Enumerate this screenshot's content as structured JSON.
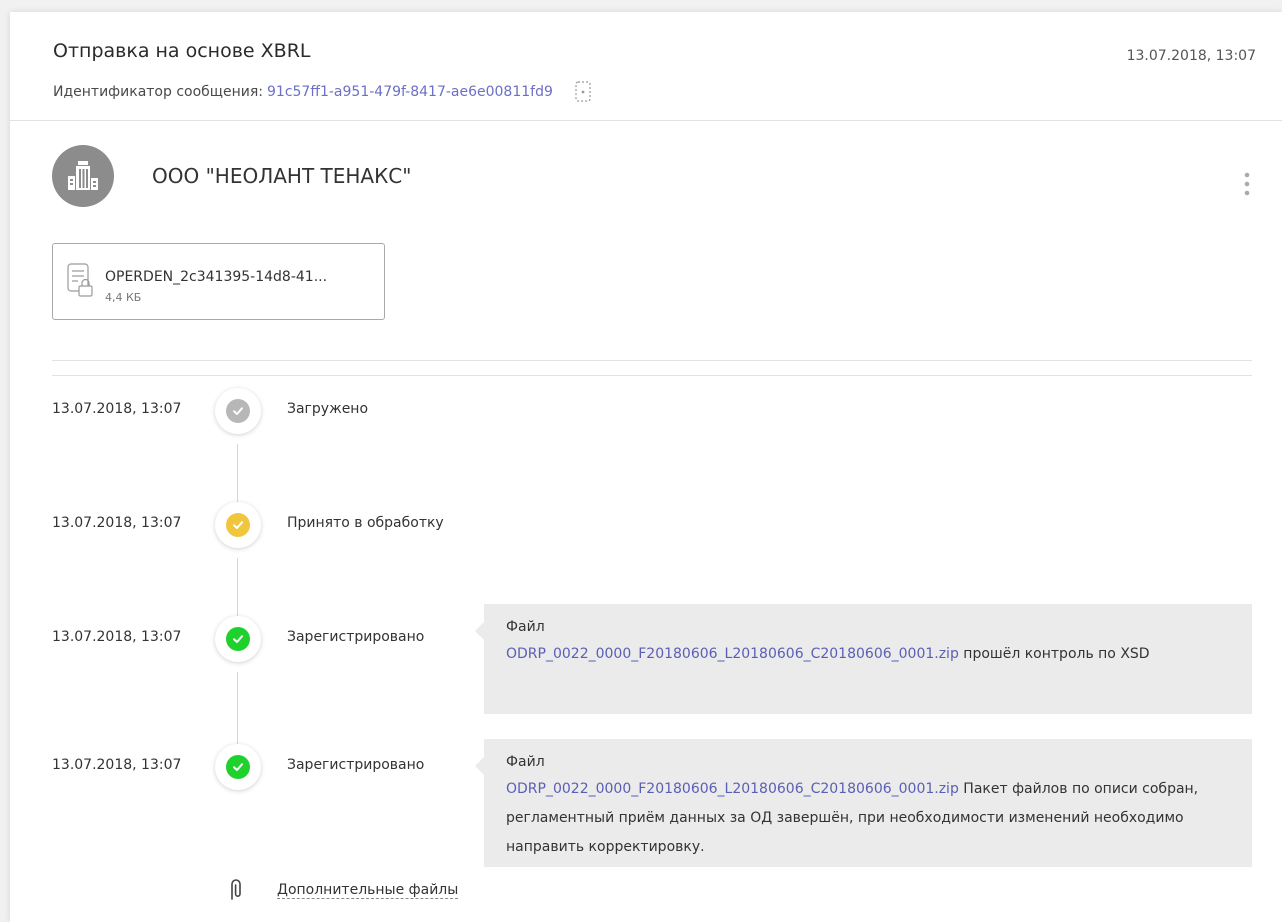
{
  "header": {
    "title": "Отправка на основе XBRL",
    "message_id_label": "Идентификатор сообщения:",
    "message_id": "91c57ff1-a951-479f-8417-ae6e00811fd9",
    "date": "13.07.2018, 13:07"
  },
  "organization": {
    "name": "ООО \"НЕОЛАНТ ТЕНАКС\""
  },
  "file": {
    "name": "OPERDEN_2c341395-14d8-41...",
    "size": "4,4 КБ"
  },
  "events": [
    {
      "date": "13.07.2018, 13:07",
      "status": "Загружено",
      "color": "#b7b7b7"
    },
    {
      "date": "13.07.2018, 13:07",
      "status": "Принято в обработку",
      "color": "#f0c63d"
    },
    {
      "date": "13.07.2018, 13:07",
      "status": "Зарегистрировано",
      "color": "#1fd12c",
      "bubble": {
        "file_word": "Файл",
        "file_name": "ODRP_0022_0000_F20180606_L20180606_C20180606_0001.zip",
        "text": " прошёл контроль по XSD"
      }
    },
    {
      "date": "13.07.2018, 13:07",
      "status": "Зарегистрировано",
      "color": "#1fd12c",
      "bubble": {
        "file_word": "Файл",
        "file_name": "ODRP_0022_0000_F20180606_L20180606_C20180606_0001.zip",
        "text": " Пакет файлов по описи собран, регламентный приём данных за ОД завершён, при необходимости изменений необходимо направить корректировку."
      }
    }
  ],
  "extra_files_label": "Дополнительные файлы"
}
